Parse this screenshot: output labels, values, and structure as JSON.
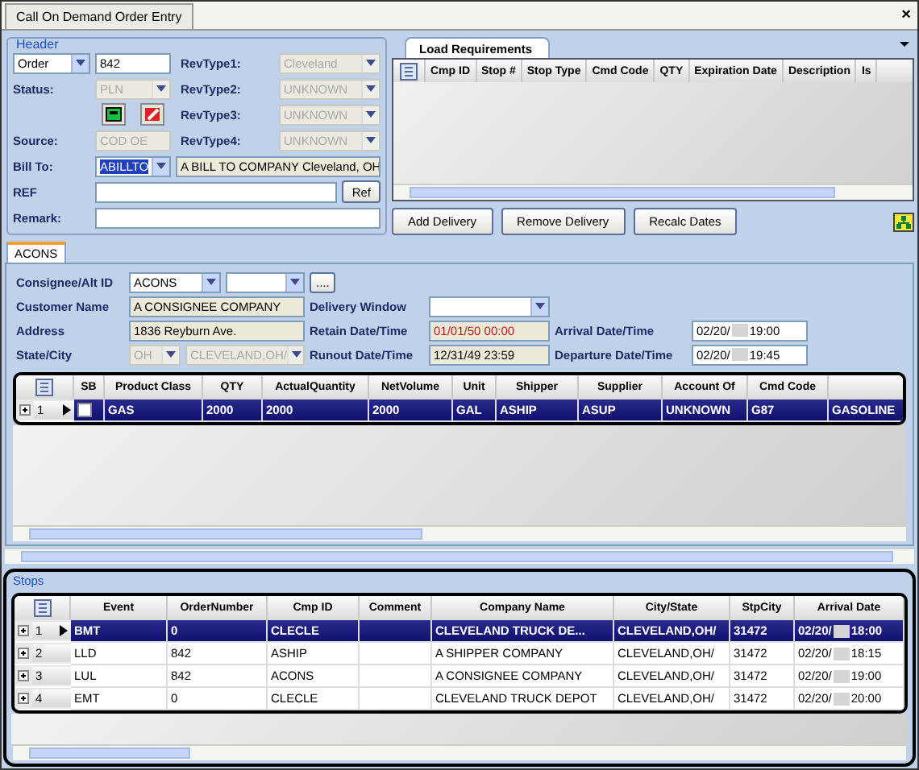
{
  "window": {
    "tab": "Call On Demand Order Entry",
    "close": "×"
  },
  "header": {
    "legend": "Header",
    "order_type": "Order",
    "order_number": "842",
    "status_label": "Status:",
    "status": "PLN",
    "source_label": "Source:",
    "source": "COD OE",
    "bill_to_label": "Bill To:",
    "bill_to": "ABILLTO",
    "bill_to_highlighted": true,
    "bill_to_name": "A BILL TO COMPANY  Cleveland, OH",
    "ref_label": "REF",
    "ref_button": "Ref",
    "remark_label": "Remark:",
    "rev_types": [
      {
        "label": "RevType1:",
        "value": "Cleveland"
      },
      {
        "label": "RevType2:",
        "value": "UNKNOWN"
      },
      {
        "label": "RevType3:",
        "value": "UNKNOWN"
      },
      {
        "label": "RevType4:",
        "value": "UNKNOWN"
      }
    ]
  },
  "load_requirements": {
    "tab": "Load Requirements",
    "columns": [
      "Cmp ID",
      "Stop #",
      "Stop Type",
      "Cmd Code",
      "QTY",
      "Expiration Date",
      "Description",
      "Is"
    ],
    "buttons": [
      "Add Delivery",
      "Remove Delivery",
      "Recalc Dates"
    ]
  },
  "consignee_tab": {
    "label": "ACONS",
    "selected": true
  },
  "consignee": {
    "alt_id_label": "Consignee/Alt ID",
    "alt_id": "ACONS",
    "browse_button": "....",
    "customer_name_label": "Customer Name",
    "customer_name": "A CONSIGNEE COMPANY",
    "address_label": "Address",
    "address": "1836 Reyburn Ave.",
    "state_city_label": "State/City",
    "state": "OH",
    "city": "CLEVELAND,OH/",
    "delivery_window_label": "Delivery Window",
    "retain_label": "Retain Date/Time",
    "retain": "01/01/50 00:00",
    "retain_alert": true,
    "runout_label": "Runout Date/Time",
    "runout": "12/31/49 23:59",
    "arrival_label": "Arrival Date/Time",
    "arrival": {
      "date": "02/20/",
      "time": "19:00"
    },
    "departure_label": "Departure Date/Time",
    "departure": {
      "date": "02/20/",
      "time": "19:45"
    }
  },
  "products": {
    "sb_column": "SB",
    "columns": [
      "Product Class",
      "QTY",
      "ActualQuantity",
      "NetVolume",
      "Unit",
      "Shipper",
      "Supplier",
      "Account Of",
      "Cmd Code"
    ],
    "rows": [
      {
        "number": "1",
        "selected": true,
        "checked": false,
        "cells": [
          "GAS",
          "2000",
          "2000",
          "2000",
          "GAL",
          "ASHIP",
          "ASUP",
          "UNKNOWN",
          "G87",
          "GASOLINE"
        ]
      }
    ]
  },
  "stops": {
    "legend": "Stops",
    "columns": [
      "Event",
      "OrderNumber",
      "Cmp ID",
      "Comment",
      "Company Name",
      "City/State",
      "StpCity",
      "Arrival Date"
    ],
    "rows": [
      {
        "number": "1",
        "selected": true,
        "cells": [
          "BMT",
          "0",
          "CLECLE",
          "",
          "CLEVELAND  TRUCK DE...",
          "CLEVELAND,OH/",
          "31472"
        ],
        "arrival": {
          "date": "02/20/",
          "time": "18:00"
        }
      },
      {
        "number": "2",
        "selected": false,
        "cells": [
          "LLD",
          "842",
          "ASHIP",
          "",
          "A SHIPPER COMPANY",
          "CLEVELAND,OH/",
          "31472"
        ],
        "arrival": {
          "date": "02/20/",
          "time": "18:15"
        }
      },
      {
        "number": "3",
        "selected": false,
        "cells": [
          "LUL",
          "842",
          "ACONS",
          "",
          "A CONSIGNEE COMPANY",
          "CLEVELAND,OH/",
          "31472"
        ],
        "arrival": {
          "date": "02/20/",
          "time": "19:00"
        }
      },
      {
        "number": "4",
        "selected": false,
        "cells": [
          "EMT",
          "0",
          "CLECLE",
          "",
          "CLEVELAND TRUCK DEPOT",
          "CLEVELAND,OH/",
          "31472"
        ],
        "arrival": {
          "date": "02/20/",
          "time": "20:00"
        }
      }
    ]
  }
}
